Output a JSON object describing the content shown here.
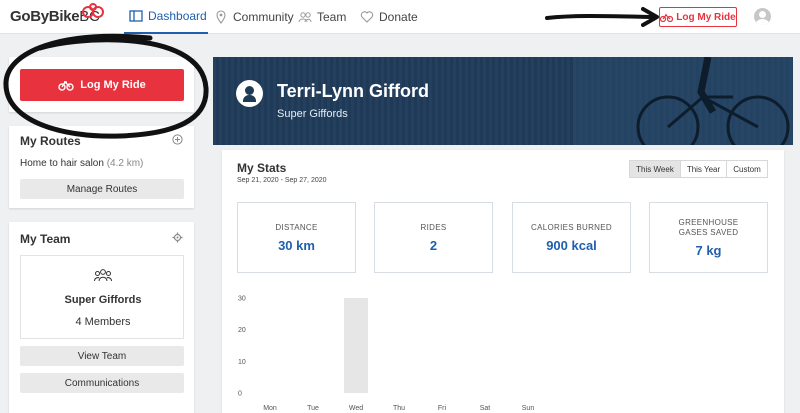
{
  "app": {
    "logo_main": "GoByBike",
    "logo_suffix": "BC"
  },
  "nav": {
    "items": [
      {
        "label": "Dashboard",
        "icon": "dashboard-icon",
        "active": true
      },
      {
        "label": "Community",
        "icon": "location-pin-icon",
        "active": false
      },
      {
        "label": "Team",
        "icon": "team-icon",
        "active": false
      },
      {
        "label": "Donate",
        "icon": "heart-icon",
        "active": false
      }
    ],
    "log_ride_label": "Log My Ride"
  },
  "sidebar": {
    "log_ride_label": "Log My Ride",
    "routes": {
      "title": "My Routes",
      "route_name": "Home to hair salon",
      "route_distance": "(4.2 km)",
      "manage_label": "Manage Routes"
    },
    "team": {
      "title": "My Team",
      "name": "Super Giffords",
      "members": "4 Members",
      "view_label": "View Team",
      "comms_label": "Communications"
    }
  },
  "profile": {
    "name": "Terri-Lynn Gifford",
    "team": "Super Giffords"
  },
  "stats": {
    "title": "My Stats",
    "date_range": "Sep 21, 2020 - Sep 27, 2020",
    "periods": [
      {
        "label": "This Week",
        "active": true
      },
      {
        "label": "This Year",
        "active": false
      },
      {
        "label": "Custom",
        "active": false
      }
    ],
    "cards": [
      {
        "label": "DISTANCE",
        "value": "30 km"
      },
      {
        "label": "RIDES",
        "value": "2"
      },
      {
        "label": "CALORIES BURNED",
        "value": "900 kcal"
      },
      {
        "label": "GREENHOUSE GASES SAVED",
        "value": "7 kg"
      }
    ]
  },
  "chart_data": {
    "type": "bar",
    "categories": [
      "Mon",
      "Tue",
      "Wed",
      "Thu",
      "Fri",
      "Sat",
      "Sun"
    ],
    "values": [
      0,
      0,
      30,
      0,
      0,
      0,
      0
    ],
    "yticks": [
      0,
      10,
      20,
      30
    ],
    "ylim": [
      0,
      30
    ],
    "title": "",
    "xlabel": "",
    "ylabel": ""
  },
  "colors": {
    "accent": "#1f5fae",
    "primary_red": "#e8333f",
    "hero_bg": "#1e3a57"
  }
}
